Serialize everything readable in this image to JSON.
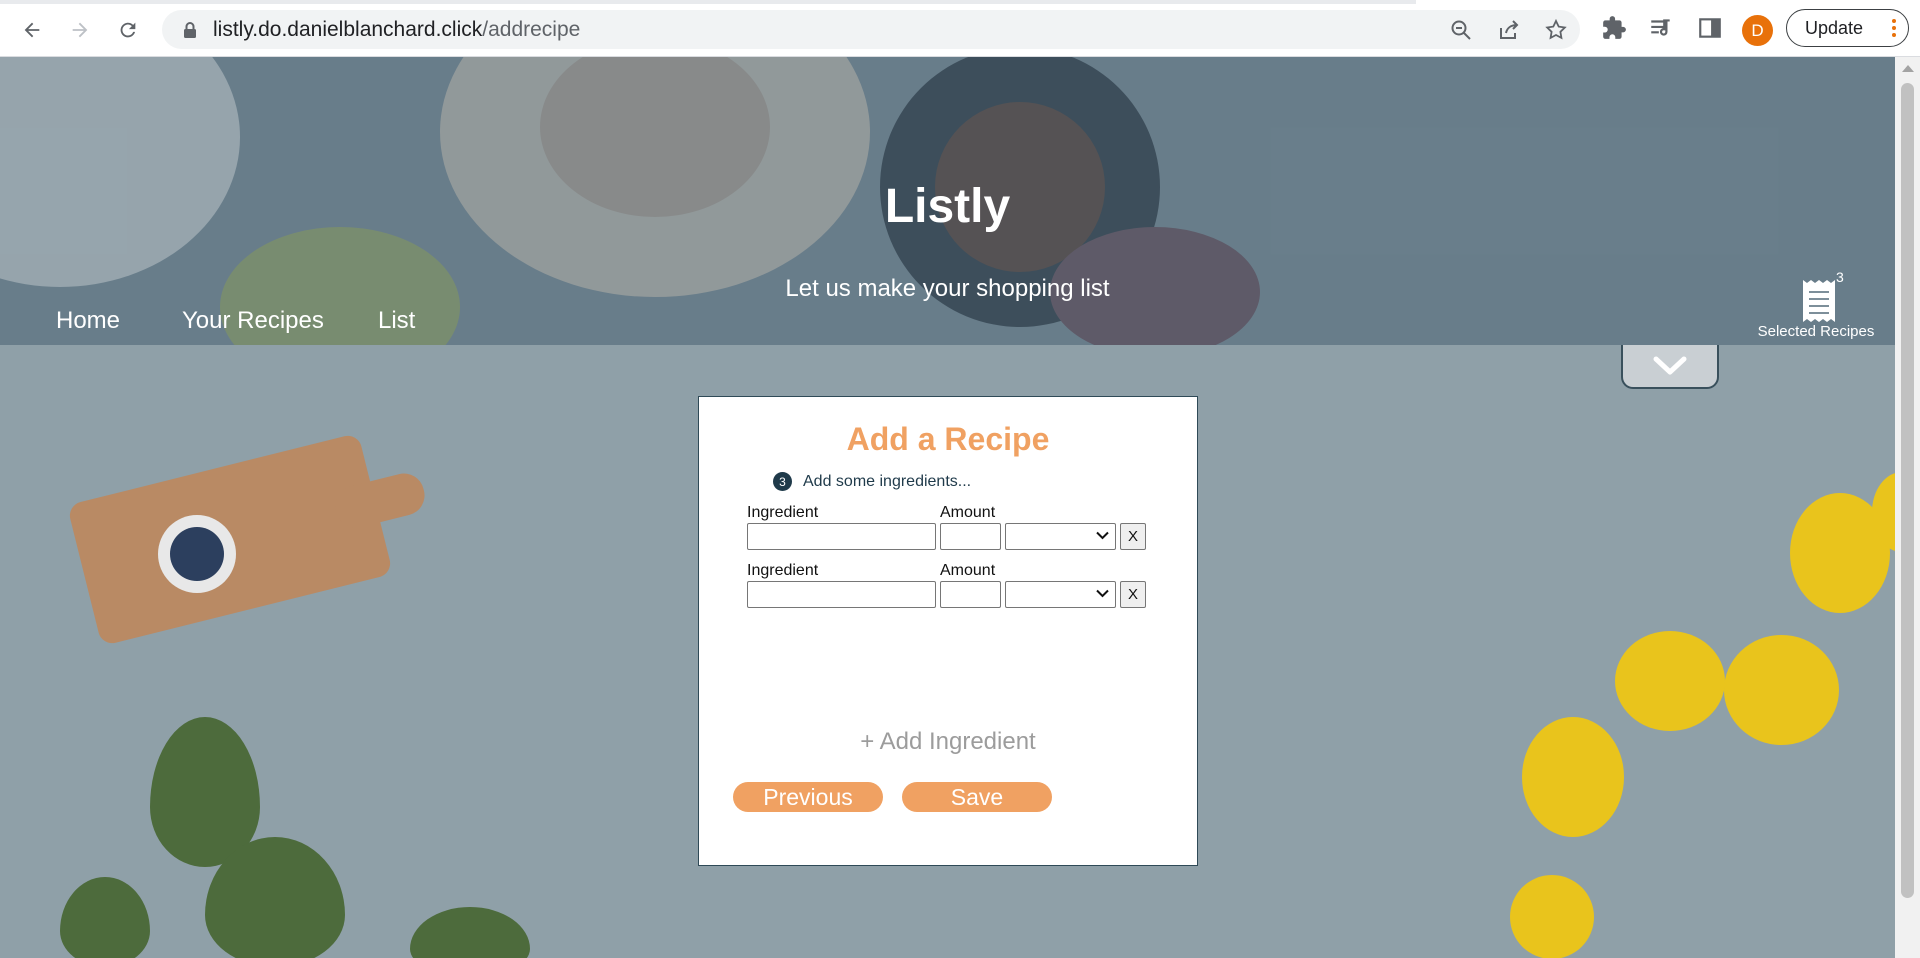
{
  "browser": {
    "url_host": "listly.do.danielblanchard.click",
    "url_path": "/addrecipe",
    "profile_initial": "D",
    "update_label": "Update",
    "icons": [
      "back-icon",
      "forward-icon",
      "reload-icon",
      "lock-icon",
      "zoom-out-icon",
      "share-icon",
      "star-icon",
      "extensions-icon",
      "media-icon",
      "side-panel-icon",
      "menu-dots-icon"
    ]
  },
  "site": {
    "title": "Listly",
    "tagline": "Let us make your shopping list",
    "nav": [
      "Home",
      "Your Recipes",
      "List"
    ],
    "cart": {
      "count": "3",
      "label": "Selected Recipes"
    }
  },
  "form": {
    "title": "Add a Recipe",
    "step_number": "3",
    "step_text": "Add some ingredients...",
    "rows": [
      {
        "ingredient_label": "Ingredient",
        "amount_label": "Amount",
        "ingredient_value": "",
        "amount_value": "",
        "unit_value": "",
        "remove_label": "X"
      },
      {
        "ingredient_label": "Ingredient",
        "amount_label": "Amount",
        "ingredient_value": "",
        "amount_value": "",
        "unit_value": "",
        "remove_label": "X"
      }
    ],
    "add_ingredient": "+ Add Ingredient",
    "previous": "Previous",
    "save": "Save"
  },
  "colors": {
    "accent": "#f0a162",
    "dark": "#1f3a4a",
    "page_bg": "#8fa0a8"
  }
}
